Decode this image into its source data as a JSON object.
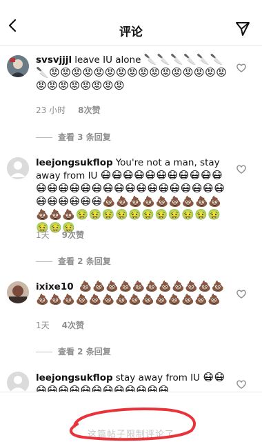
{
  "header": {
    "title": "评论"
  },
  "comments": [
    {
      "user": "svsvjjjl",
      "text": "leave IU alone",
      "emoji": "🔪🔪🔪🔪🔪🔪🔪😡😡😡😡😡😡😡😡😡😡😡😡😡😡😡😡😡😡😡😡😡😡😡😡",
      "time": "23 小时",
      "likes": "8次赞",
      "replies": "查看 3 条回复"
    },
    {
      "user": "leejongsukflop",
      "text": "You're not a man, stay away from IU",
      "emoji": "😷😷😷😷😷😷😷😷😷😷😷😷😷😷😷😷😷😷😷😷😷😷😷😷😷😷😷😷😷😷😷😷😷😷💩💩💩💩💩💩💩💩💩💩💩💩🤢🤢🤢🤢🤢🤢🤢🤢🤢🤢🤢🤢🤢🤢",
      "time": "1天",
      "likes": "9次赞",
      "replies": "查看 2 条回复"
    },
    {
      "user": "ixixe10",
      "text": "",
      "emoji": "💩💩💩💩💩💩💩💩💩💩💩💩💩💩💩💩💩💩💩💩💩💩💩💩💩",
      "time": "1天",
      "likes": "4次赞",
      "replies": "查看 2 条回复"
    },
    {
      "user": "leejongsukflop",
      "text": "stay away from IU",
      "emoji": "😷😷😷😷😷😷😷😷😷😷😷😷😷😷",
      "time": "",
      "likes": "",
      "replies": ""
    }
  ],
  "footer": {
    "notice": "这篇帖子限制评论了"
  },
  "colors": {
    "muted": "#8e8e8e",
    "scribble": "#e8333a"
  }
}
